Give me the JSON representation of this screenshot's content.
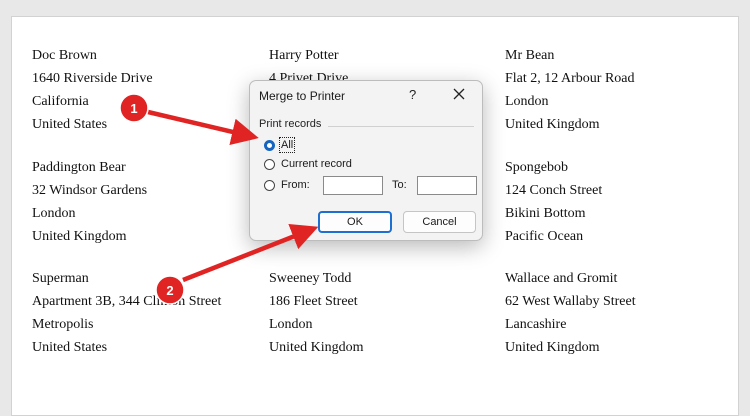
{
  "labels": [
    [
      "Doc Brown",
      "1640 Riverside Drive",
      "California",
      "United States"
    ],
    [
      "Harry Potter",
      "4 Privet Drive",
      "",
      ""
    ],
    [
      "Mr Bean",
      "Flat 2, 12 Arbour Road",
      "London",
      "United Kingdom"
    ],
    [
      "Paddington Bear",
      "32 Windsor Gardens",
      "London",
      "United Kingdom"
    ],
    [
      "",
      "",
      "",
      ""
    ],
    [
      "Spongebob",
      "124 Conch Street",
      "Bikini Bottom",
      "Pacific Ocean"
    ],
    [
      "Superman",
      "Apartment 3B, 344 Clinton Street",
      "Metropolis",
      "United States"
    ],
    [
      "Sweeney Todd",
      "186 Fleet Street",
      "London",
      "United Kingdom"
    ],
    [
      "Wallace and Gromit",
      "62 West Wallaby Street",
      "Lancashire",
      "United Kingdom"
    ]
  ],
  "dialog": {
    "title": "Merge to Printer",
    "help": "?",
    "group_label": "Print records",
    "option_all": "All",
    "option_current": "Current record",
    "from_label": "From:",
    "to_label": "To:",
    "from_value": "",
    "to_value": "",
    "ok_label": "OK",
    "cancel_label": "Cancel"
  },
  "annotations": {
    "badge_1": "1",
    "badge_2": "2",
    "color": "#e02424"
  }
}
